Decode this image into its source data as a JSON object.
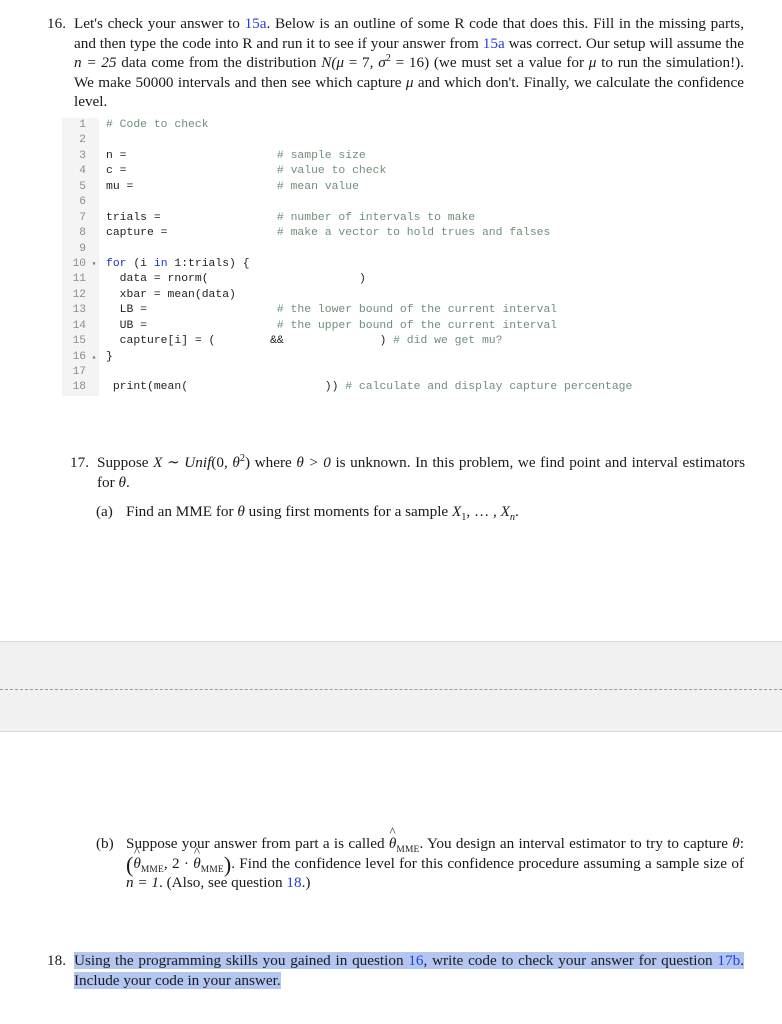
{
  "document": {
    "type": "statistics-homework-worksheet"
  },
  "problem16": {
    "number": "16.",
    "text_part1": "Let's check your answer to ",
    "ref1": "15a",
    "text_part2": ". Below is an outline of some R code that does this. Fill in the missing parts, and then type the code into R and run it to see if your answer from ",
    "ref2": "15a",
    "text_part3": " was correct. Our setup will assume the ",
    "math_n": "n = 25",
    "text_part4": " data come from the distribution ",
    "math_dist_open": "N(",
    "math_mu": "μ",
    "math_mu_eq": " = 7, ",
    "math_sigma": "σ",
    "math_sigma_sup": "2",
    "math_sigma_eq": " = 16)",
    "text_part5": " (we must set a value for ",
    "math_mu2": "μ",
    "text_part6": " to run the simulation!). We make 50000 intervals and then see which capture ",
    "math_mu3": "μ",
    "text_part7": " and which don't. Finally, we calculate the confidence level."
  },
  "code": {
    "lines": [
      {
        "num": "1",
        "fold": "",
        "segments": [
          {
            "t": "# Code to check",
            "c": "cmt"
          }
        ]
      },
      {
        "num": "2",
        "fold": "",
        "segments": []
      },
      {
        "num": "3",
        "fold": "",
        "segments": [
          {
            "t": "n =",
            "c": ""
          },
          {
            "t": "                      ",
            "c": ""
          },
          {
            "t": "# sample size",
            "c": "cmt"
          }
        ]
      },
      {
        "num": "4",
        "fold": "",
        "segments": [
          {
            "t": "c =",
            "c": ""
          },
          {
            "t": "                      ",
            "c": ""
          },
          {
            "t": "# value to check",
            "c": "cmt"
          }
        ]
      },
      {
        "num": "5",
        "fold": "",
        "segments": [
          {
            "t": "mu =",
            "c": ""
          },
          {
            "t": "                     ",
            "c": ""
          },
          {
            "t": "# mean value",
            "c": "cmt"
          }
        ]
      },
      {
        "num": "6",
        "fold": "",
        "segments": []
      },
      {
        "num": "7",
        "fold": "",
        "segments": [
          {
            "t": "trials =",
            "c": ""
          },
          {
            "t": "                 ",
            "c": ""
          },
          {
            "t": "# number of intervals to make",
            "c": "cmt"
          }
        ]
      },
      {
        "num": "8",
        "fold": "",
        "segments": [
          {
            "t": "capture =",
            "c": ""
          },
          {
            "t": "                ",
            "c": ""
          },
          {
            "t": "# make a vector to hold trues and falses",
            "c": "cmt"
          }
        ]
      },
      {
        "num": "9",
        "fold": "",
        "segments": []
      },
      {
        "num": "10",
        "fold": "▾",
        "segments": [
          {
            "t": "for",
            "c": "kw"
          },
          {
            "t": " (i ",
            "c": ""
          },
          {
            "t": "in",
            "c": "kw"
          },
          {
            "t": " 1:trials) {",
            "c": ""
          }
        ]
      },
      {
        "num": "11",
        "fold": "",
        "segments": [
          {
            "t": "  data = rnorm(",
            "c": ""
          },
          {
            "t": "                      ",
            "c": ""
          },
          {
            "t": ")",
            "c": ""
          }
        ]
      },
      {
        "num": "12",
        "fold": "",
        "segments": [
          {
            "t": "  xbar = mean(data)",
            "c": ""
          }
        ]
      },
      {
        "num": "13",
        "fold": "",
        "segments": [
          {
            "t": "  LB =",
            "c": ""
          },
          {
            "t": "                   ",
            "c": ""
          },
          {
            "t": "# the lower bound of the current interval",
            "c": "cmt"
          }
        ]
      },
      {
        "num": "14",
        "fold": "",
        "segments": [
          {
            "t": "  UB =",
            "c": ""
          },
          {
            "t": "                   ",
            "c": ""
          },
          {
            "t": "# the upper bound of the current interval",
            "c": "cmt"
          }
        ]
      },
      {
        "num": "15",
        "fold": "",
        "segments": [
          {
            "t": "  capture[i] = (",
            "c": ""
          },
          {
            "t": "        ",
            "c": ""
          },
          {
            "t": "&&",
            "c": ""
          },
          {
            "t": "              ",
            "c": ""
          },
          {
            "t": ") ",
            "c": ""
          },
          {
            "t": "# did we get mu?",
            "c": "cmt"
          }
        ]
      },
      {
        "num": "16",
        "fold": "▴",
        "segments": [
          {
            "t": "}",
            "c": ""
          }
        ]
      },
      {
        "num": "17",
        "fold": "",
        "segments": []
      },
      {
        "num": "18",
        "fold": "",
        "segments": [
          {
            "t": " print(mean(",
            "c": ""
          },
          {
            "t": "                    ",
            "c": ""
          },
          {
            "t": ")) ",
            "c": ""
          },
          {
            "t": "# calculate and display capture percentage",
            "c": "cmt"
          }
        ]
      }
    ]
  },
  "problem17": {
    "number": "17.",
    "intro_part1": "Suppose ",
    "math_X": "X",
    "math_tilde": " ∼ ",
    "math_unif": "Unif",
    "math_unif_args_open": "(0, ",
    "math_theta": "θ",
    "math_theta_sup": "2",
    "math_unif_args_close": ")",
    "intro_part2": " where ",
    "math_theta_gt": "θ > 0",
    "intro_part3": " is unknown. In this problem, we find point and interval estimators for ",
    "math_theta2": "θ",
    "intro_part4": ".",
    "part_a": {
      "label": "(a)",
      "text_part1": "Find an MME for ",
      "math_theta": "θ",
      "text_part2": " using first moments for a sample ",
      "math_sample_X": "X",
      "math_sample_sub1": "1",
      "math_sample_dots": ", … , ",
      "math_sample_Xn": "X",
      "math_sample_subn": "n",
      "text_part3": "."
    },
    "part_b": {
      "label": "(b)",
      "text_part1": "Suppose your answer from part a is called ",
      "theta_hat": "θ",
      "theta_hat_sub": "MME",
      "text_part2": ". You design an interval estimator to try to capture ",
      "math_theta": "θ",
      "text_colon": ": ",
      "interval_open": "(",
      "interval_first_hat": "θ",
      "interval_first_sub": "MME",
      "interval_mid": ", 2 · ",
      "interval_second_hat": "θ",
      "interval_second_sub": "MME",
      "interval_close": ")",
      "text_part3": ". Find the confidence level for this confidence procedure assuming a sample size of ",
      "math_n": "n = 1",
      "text_part4": ". (Also, see question ",
      "ref18": "18",
      "text_part5": ".)"
    }
  },
  "problem18": {
    "number": "18.",
    "text_part1": "Using the programming skills you gained in question ",
    "ref16": "16",
    "text_part2": ", write code to check your answer for question ",
    "ref17b": "17b",
    "text_part3": ". Include your code in your answer."
  },
  "colors": {
    "link": "#2141e0",
    "comment": "#6f8f7a",
    "keyword": "#1d32c8",
    "gutter_bg": "#f4f4f4",
    "band_bg": "#f1f1f1",
    "selection": "#b3c6f2"
  }
}
